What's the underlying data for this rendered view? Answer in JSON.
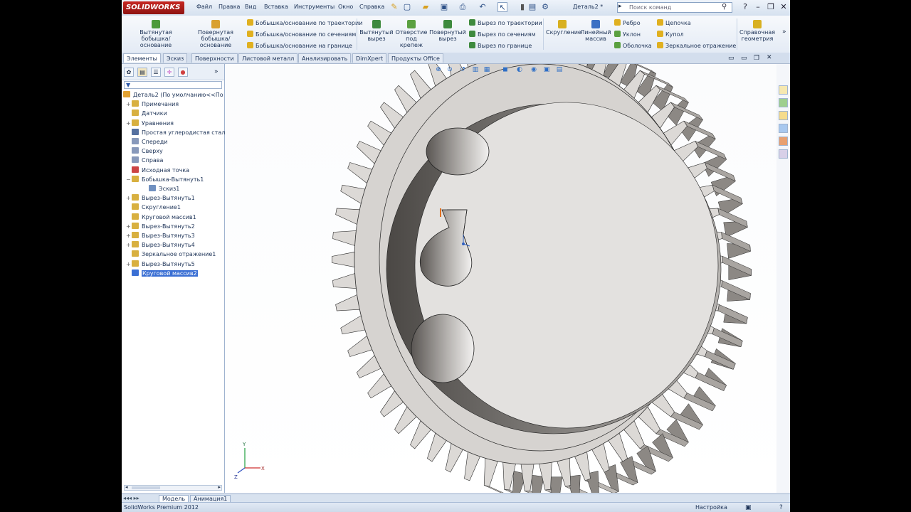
{
  "app": {
    "logo_text": "SOLIDWORKS",
    "menus": [
      "Файл",
      "Правка",
      "Вид",
      "Вставка",
      "Инструменты",
      "Окно",
      "Справка"
    ],
    "document_title": "Деталь2 *",
    "search_placeholder": "Поиск команд"
  },
  "command_manager": {
    "big_buttons": [
      {
        "label": "Вытянутая бобышка/основание",
        "icon": "extrude-boss-icon"
      },
      {
        "label": "Повернутая бобышка/основание",
        "icon": "revolve-boss-icon"
      },
      {
        "label": "Вытянутый вырез",
        "icon": "extrude-cut-icon"
      },
      {
        "label": "Отверстие под крепеж",
        "icon": "hole-wizard-icon"
      },
      {
        "label": "Повернутый вырез",
        "icon": "revolve-cut-icon"
      },
      {
        "label": "Скругление",
        "icon": "fillet-icon"
      },
      {
        "label": "Линейный массив",
        "icon": "linear-pattern-icon"
      },
      {
        "label": "Справочная геометрия",
        "icon": "reference-geometry-icon"
      }
    ],
    "small_buttons": [
      "Бобышка/основание по траектории",
      "Бобышка/основание по сечениям",
      "Бобышка/основание на границе",
      "Вырез по траектории",
      "Вырез по сечениям",
      "Вырез по границе",
      "Ребро",
      "Уклон",
      "Оболочка",
      "Цепочка",
      "Купол",
      "Зеркальное отражение"
    ]
  },
  "tabs": [
    "Элементы",
    "Эскиз",
    "Поверхности",
    "Листовой металл",
    "Анализировать",
    "DimXpert",
    "Продукты Office"
  ],
  "active_tab": "Элементы",
  "feature_tree": {
    "filter_label": "▼",
    "items": [
      {
        "label": "Деталь2  (По умолчанию<<По",
        "level": 0,
        "icon": "part-icon",
        "color": "#e0a030"
      },
      {
        "label": "Примечания",
        "level": 1,
        "icon": "annotations-icon",
        "color": "#d8b040",
        "expand": "+"
      },
      {
        "label": "Датчики",
        "level": 1,
        "icon": "sensors-icon",
        "color": "#d8b040"
      },
      {
        "label": "Уравнения",
        "level": 1,
        "icon": "equations-icon",
        "color": "#d8b040",
        "expand": "+"
      },
      {
        "label": "Простая углеродистая стал",
        "level": 1,
        "icon": "material-icon",
        "color": "#5570a0"
      },
      {
        "label": "Спереди",
        "level": 1,
        "icon": "plane-icon",
        "color": "#8899bb"
      },
      {
        "label": "Сверху",
        "level": 1,
        "icon": "plane-icon",
        "color": "#8899bb"
      },
      {
        "label": "Справа",
        "level": 1,
        "icon": "plane-icon",
        "color": "#8899bb"
      },
      {
        "label": "Исходная точка",
        "level": 1,
        "icon": "origin-icon",
        "color": "#cc4444"
      },
      {
        "label": "Бобышка-Вытянуть1",
        "level": 1,
        "icon": "extrude-icon",
        "color": "#d8b040",
        "expand": "−"
      },
      {
        "label": "Эскиз1",
        "level": 2,
        "icon": "sketch-icon",
        "color": "#7090c0"
      },
      {
        "label": "Вырез-Вытянуть1",
        "level": 1,
        "icon": "cut-icon",
        "color": "#d8b040",
        "expand": "+"
      },
      {
        "label": "Скругление1",
        "level": 1,
        "icon": "fillet-icon",
        "color": "#d8b040"
      },
      {
        "label": "Круговой массив1",
        "level": 1,
        "icon": "circular-pattern-icon",
        "color": "#d8b040"
      },
      {
        "label": "Вырез-Вытянуть2",
        "level": 1,
        "icon": "cut-icon",
        "color": "#d8b040",
        "expand": "+"
      },
      {
        "label": "Вырез-Вытянуть3",
        "level": 1,
        "icon": "cut-icon",
        "color": "#d8b040",
        "expand": "+"
      },
      {
        "label": "Вырез-Вытянуть4",
        "level": 1,
        "icon": "cut-icon",
        "color": "#d8b040",
        "expand": "+"
      },
      {
        "label": "Зеркальное отражение1",
        "level": 1,
        "icon": "mirror-icon",
        "color": "#d8b040"
      },
      {
        "label": "Вырез-Вытянуть5",
        "level": 1,
        "icon": "cut-icon",
        "color": "#d8b040",
        "expand": "+"
      },
      {
        "label": "Круговой массив2",
        "level": 1,
        "icon": "circular-pattern-icon",
        "color": "#3a6fd4",
        "selected": true
      }
    ]
  },
  "bottom_tabs": [
    "Модель",
    "Анимация1"
  ],
  "active_bottom_tab": "Модель",
  "status": {
    "left": "SolidWorks Premium 2012",
    "right": "Настройка"
  },
  "colors": {
    "accent": "#3a6fd4",
    "brand": "#c72822",
    "gear_face": "#e3e1df"
  }
}
